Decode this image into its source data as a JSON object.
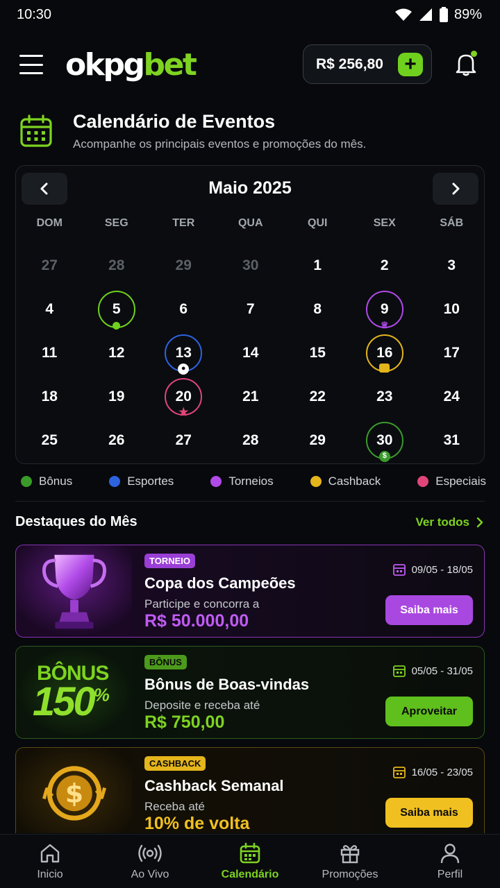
{
  "status_bar": {
    "time": "10:30",
    "battery": "89%"
  },
  "header": {
    "logo_part1": "okpg",
    "logo_part2": "bet",
    "balance": "R$ 256,80",
    "add_button": "+"
  },
  "page": {
    "title": "Calendário de Eventos",
    "subtitle": "Acompanhe os principais eventos e promoções do mês."
  },
  "calendar": {
    "month_label": "Maio 2025",
    "weekdays": [
      "DOM",
      "SEG",
      "TER",
      "QUA",
      "QUI",
      "SEX",
      "SÁB"
    ],
    "days": [
      "27",
      "28",
      "29",
      "30",
      "1",
      "2",
      "3",
      "4",
      "5",
      "6",
      "7",
      "8",
      "9",
      "10",
      "11",
      "12",
      "13",
      "14",
      "15",
      "16",
      "17",
      "18",
      "19",
      "20",
      "21",
      "22",
      "23",
      "24",
      "25",
      "26",
      "27",
      "28",
      "29",
      "30",
      "31"
    ],
    "muted_days_count": 4,
    "events": [
      {
        "day": "5",
        "type": "bonus",
        "color": "#6fd11e",
        "icon": "dot-icon"
      },
      {
        "day": "9",
        "type": "torneios",
        "color": "#b04ae8",
        "icon": "trophy-icon"
      },
      {
        "day": "13",
        "type": "esportes",
        "color": "#2e63e0",
        "icon": "soccer-ball-icon"
      },
      {
        "day": "16",
        "type": "cashback",
        "color": "#e5b51c",
        "icon": "gift-icon"
      },
      {
        "day": "20",
        "type": "especiais",
        "color": "#e0457a",
        "icon": "star-icon"
      },
      {
        "day": "30",
        "type": "bonus",
        "color": "#3a9b2a",
        "icon": "dollar-icon"
      }
    ]
  },
  "legend": [
    {
      "label": "Bônus",
      "color": "#3a9b2a"
    },
    {
      "label": "Esportes",
      "color": "#2e63e0"
    },
    {
      "label": "Torneios",
      "color": "#b04ae8"
    },
    {
      "label": "Cashback",
      "color": "#e5b51c"
    },
    {
      "label": "Especiais",
      "color": "#e0457a"
    }
  ],
  "highlights": {
    "title": "Destaques do Mês",
    "see_all": "Ver todos",
    "cards": [
      {
        "tag": "TORNEIO",
        "title": "Copa dos Campeões",
        "subtitle": "Participe e concorra a",
        "amount": "R$ 50.000,00",
        "dates": "09/05 - 18/05",
        "cta": "Saiba mais",
        "accent": "#b04ae8"
      },
      {
        "tag": "BÔNUS",
        "title": "Bônus de Boas-vindas",
        "subtitle": "Deposite e receba até",
        "amount": "R$ 750,00",
        "dates": "05/05 - 31/05",
        "cta": "Aproveitar",
        "accent": "#6fd11e",
        "art_line1": "BÔNUS",
        "art_line2": "150",
        "art_sup": "%"
      },
      {
        "tag": "CASHBACK",
        "title": "Cashback Semanal",
        "subtitle": "Receba até",
        "amount": "10% de volta",
        "dates": "16/05 - 23/05",
        "cta": "Saiba mais",
        "accent": "#e5b51c"
      }
    ]
  },
  "bottom_nav": [
    {
      "label": "Inicio",
      "icon": "home-icon",
      "active": false
    },
    {
      "label": "Ao Vivo",
      "icon": "live-broadcast-icon",
      "active": false
    },
    {
      "label": "Calendário",
      "icon": "calendar-icon",
      "active": true
    },
    {
      "label": "Promoções",
      "icon": "gift-icon",
      "active": false
    },
    {
      "label": "Perfil",
      "icon": "user-icon",
      "active": false
    }
  ]
}
